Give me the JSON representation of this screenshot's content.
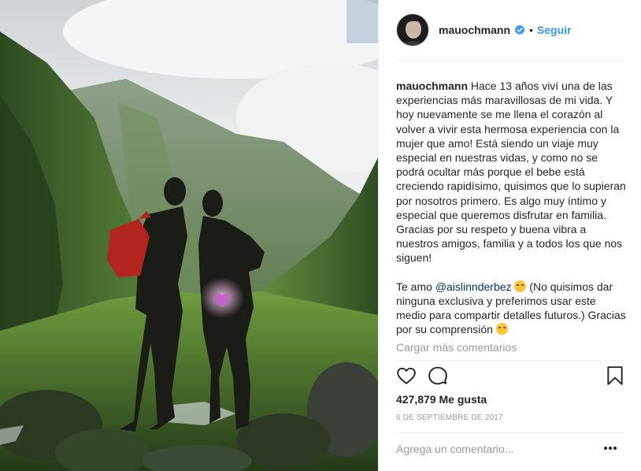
{
  "post": {
    "username": "mauochmann",
    "separator": "•",
    "follow_label": "Seguir",
    "caption": {
      "username": "mauochmann",
      "paragraph1": "Hace 13 años viví una de las experiencias más maravillosas de mi vida. Y hoy nuevamente se me llena el corazón al volver a vivir esta hermosa experiencia con la mujer que amo! Está siendo un viaje muy especial en nuestras vidas, y como no se podrá ocultar más porque el bebe está creciendo rapidísimo, quisimos que lo supieran por nosotros primero. Es algo muy íntimo y especial que queremos disfrutar en familia. Gracias por su respeto y buena vibra a nuestros amigos, familia y a todos los que nos siguen!",
      "paragraph2_prefix": "Te amo",
      "mention": "@aislinnderbez",
      "paragraph2_suffix": "(No quisimos dar ninguna exclusiva y preferimos usar este medio para compartir detalles futuros.) Gracias por su comprensión"
    },
    "load_more_label": "Cargar más comentarios",
    "likes_text": "427,879 Me gusta",
    "date_text": "6 DE SEPTIEMBRE DE 2017",
    "comment_placeholder": "Agrega un comentario...",
    "icons": {
      "like": "heart-icon",
      "comment": "comment-bubble-icon",
      "save": "bookmark-icon",
      "options": "more-options-icon",
      "verified": "verified-badge-icon",
      "emoji_kiss": "kiss-emoji-icon",
      "emoji_wink": "wink-emoji-icon"
    },
    "colors": {
      "link_blue": "#3897f0",
      "mention_blue": "#003569",
      "muted_text": "#999999",
      "text": "#262626",
      "divider": "#efefef"
    }
  }
}
